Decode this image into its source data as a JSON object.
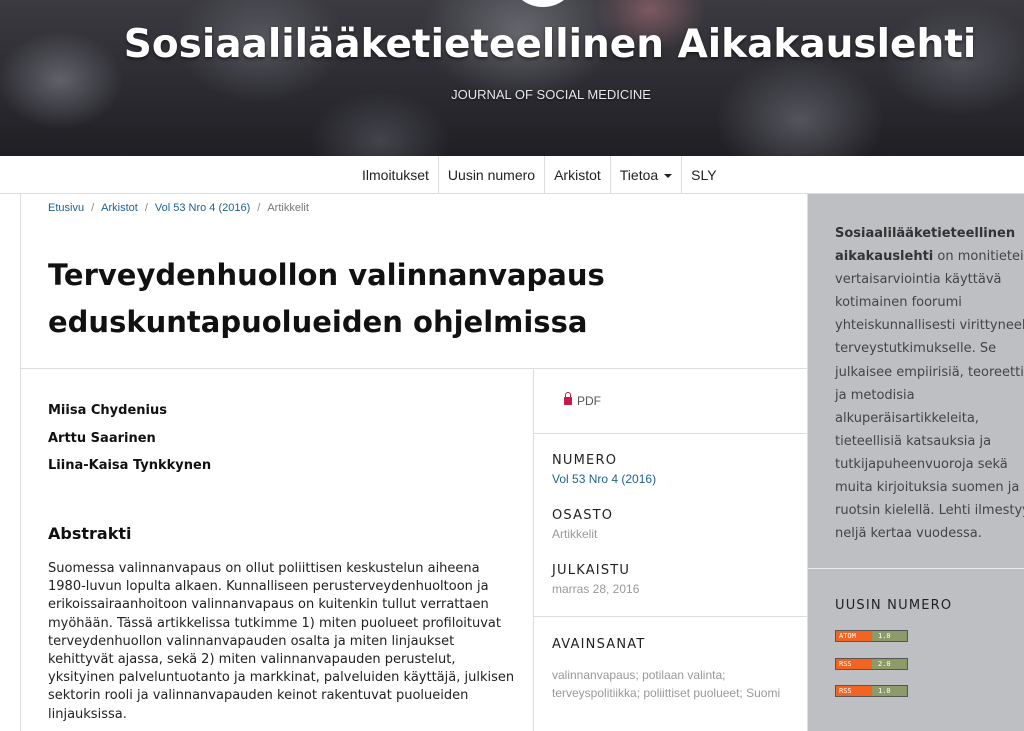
{
  "header": {
    "title": "Sosiaalilääketieteellinen Aikakauslehti",
    "subtitle": "JOURNAL OF SOCIAL MEDICINE"
  },
  "nav": {
    "items": [
      "Ilmoitukset",
      "Uusin numero",
      "Arkistot",
      "Tietoa",
      "SLY"
    ]
  },
  "breadcrumb": {
    "home": "Etusivu",
    "archive": "Arkistot",
    "issue": "Vol 53 Nro 4 (2016)",
    "current": "Artikkelit"
  },
  "article": {
    "title": "Terveydenhuollon valinnanvapaus eduskuntapuolueiden ohjelmissa",
    "authors": [
      "Miisa Chydenius",
      "Arttu Saarinen",
      "Liina-Kaisa Tynkkynen"
    ],
    "abstract_heading": "Abstrakti",
    "abstract_text": "Suomessa valinnanvapaus on ollut poliittisen keskustelun aiheena 1980-luvun lopulta alkaen. Kunnalliseen perusterveydenhuoltoon ja erikoissairaanhoitoon valinnanvapaus on kuitenkin tullut verrattaen myöhään. Tässä artikkelissa tutkimme 1) miten puolueet profiloituvat terveydenhuollon valinnanvapauden osalta ja miten linjaukset kehittyvät ajassa, sekä 2) miten valinnanvapauden perustelut, yksityinen palveluntuotanto ja markkinat, palveluiden käyttäjä, julkisen sektorin rooli ja valinnanvapauden keinot rakentuvat puolueiden linjauksissa."
  },
  "details": {
    "pdf_label": "PDF",
    "issue_label": "NUMERO",
    "issue_value": "Vol 53 Nro 4 (2016)",
    "section_label": "OSASTO",
    "section_value": "Artikkelit",
    "published_label": "JULKAISTU",
    "published_value": "marras 28, 2016",
    "keywords_label": "AVAINSANAT",
    "keywords_value": "valinnanvapaus; potilaan valinta; terveyspolitiikka; poliittiset puolueet; Suomi"
  },
  "sidebar": {
    "about_lines": [
      "on monitieteinen",
      "vertaisarviointia käyttävä",
      "kotimainen foorumi",
      "yhteiskunnallisesti virittyneelle",
      "terveystutkimukselle. Se",
      "julkaisee empiirisiä, teoreettisia",
      "ja metodisia",
      "alkuperäisartikkeleita,",
      "tieteellisiä katsauksia ja",
      "tutkijapuheenvuoroja sekä",
      "muita kirjoituksia suomen ja",
      "ruotsin kielellä. Lehti ilmestyy",
      "neljä kertaa vuodessa."
    ],
    "about_strong_1": "Sosiaalilääketieteellinen",
    "about_strong_2": "aikakauslehti",
    "latest_heading": "UUSIN NUMERO",
    "feeds": [
      {
        "left": "ATOM",
        "right": "1.0"
      },
      {
        "left": "RSS",
        "right": "2.0"
      },
      {
        "left": "RSS",
        "right": "1.0"
      }
    ]
  }
}
